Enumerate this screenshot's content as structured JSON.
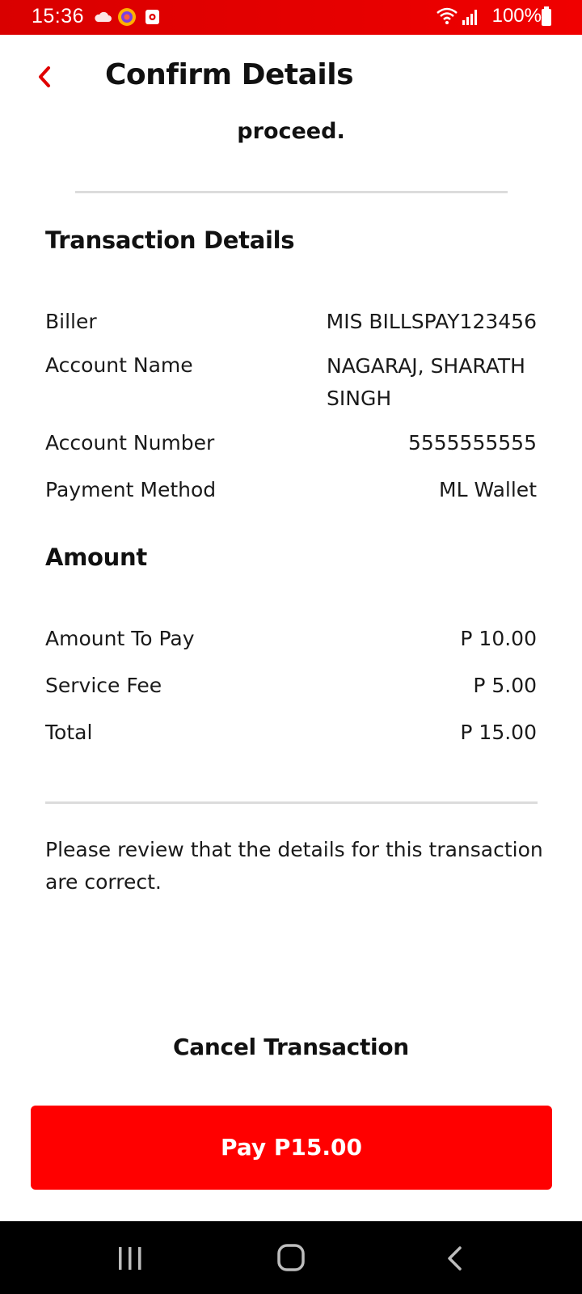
{
  "status_bar": {
    "time": "15:36",
    "battery": "100%",
    "icons": [
      "cloud-icon",
      "browser-icon",
      "camera-app-icon",
      "wifi-icon",
      "signal-icon",
      "battery-icon"
    ]
  },
  "header": {
    "title": "Confirm Details",
    "back_icon": "chevron-left-icon"
  },
  "intro_tail": "proceed.",
  "transaction": {
    "title": "Transaction Details",
    "rows": [
      {
        "label": "Biller",
        "value": "MIS BILLSPAY123456"
      },
      {
        "label": "Account Name",
        "value_line1": "NAGARAJ, SHARATH",
        "value_line2": "SINGH"
      },
      {
        "label": "Account Number",
        "value": "5555555555"
      },
      {
        "label": "Payment Method",
        "value": "ML Wallet"
      }
    ]
  },
  "amount": {
    "title": "Amount",
    "rows": [
      {
        "label": "Amount To Pay",
        "value": "P 10.00"
      },
      {
        "label": "Service Fee",
        "value": "P 5.00"
      },
      {
        "label": "Total",
        "value": "P 15.00"
      }
    ]
  },
  "note": "Please review that the details for this transaction are correct.",
  "actions": {
    "cancel_label": "Cancel Transaction",
    "pay_label": "Pay P15.00"
  },
  "colors": {
    "accent": "#ff0000",
    "status_bar": "#e60000",
    "nav_bar": "#000000"
  }
}
